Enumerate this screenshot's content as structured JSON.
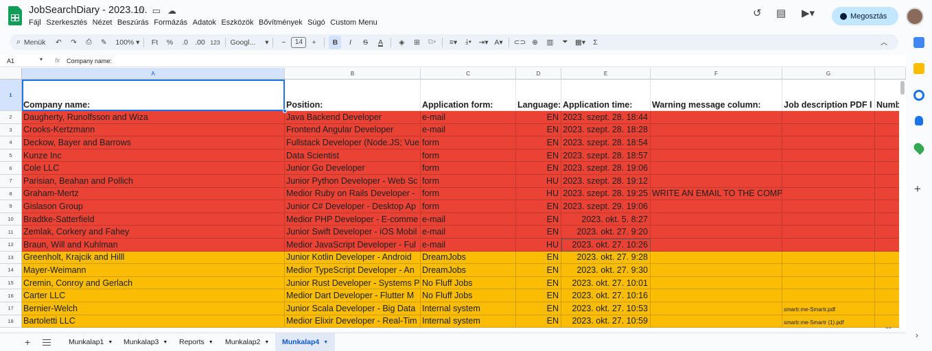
{
  "app": {
    "title": "JobSearchDiary - 2023.10.",
    "menus": [
      "Fájl",
      "Szerkesztés",
      "Nézet",
      "Beszúrás",
      "Formázás",
      "Adatok",
      "Eszközök",
      "Bővítmények",
      "Súgó",
      "Custom Menu"
    ],
    "share_label": "Megosztás"
  },
  "toolbar": {
    "search_label": "Menük",
    "zoom": "100%",
    "currency": "Ft",
    "percent": "%",
    "decimal_less": ".0",
    "decimal_more": ".00",
    "number_format": "123",
    "font": "Googl...",
    "font_size": "14",
    "bold": "B",
    "italic": "I",
    "strike": "S",
    "text_color": "A"
  },
  "formula_bar": {
    "cell_ref": "A1",
    "fx": "fx",
    "content": "Company name:"
  },
  "columns": [
    "A",
    "B",
    "C",
    "D",
    "E",
    "F",
    "G",
    ""
  ],
  "headers": [
    "Company name:",
    "Position:",
    "Application form:",
    "Language:",
    "Application time:",
    "Warning message column:",
    "Job description PDF l",
    "Numb"
  ],
  "rows": [
    {
      "n": "2",
      "color": "#ea4335",
      "cells": [
        "Daugherty, Runolfsson and Wiza",
        "Java Backend Developer",
        "e-mail",
        "EN",
        "2023. szept. 28. 18:44",
        "",
        ""
      ]
    },
    {
      "n": "3",
      "color": "#ea4335",
      "cells": [
        "Crooks-Kertzmann",
        "Frontend Angular Developer",
        "e-mail",
        "EN",
        "2023. szept. 28. 18:28",
        "",
        ""
      ]
    },
    {
      "n": "4",
      "color": "#ea4335",
      "cells": [
        "Deckow, Bayer and Barrows",
        "Fullstack Developer (Node.JS; Vue",
        "form",
        "EN",
        "2023. szept. 28. 18:54",
        "",
        ""
      ]
    },
    {
      "n": "5",
      "color": "#ea4335",
      "cells": [
        "Kunze Inc",
        "Data Scientist",
        "form",
        "EN",
        "2023. szept. 28. 18:57",
        "",
        ""
      ]
    },
    {
      "n": "6",
      "color": "#ea4335",
      "cells": [
        "Cole LLC",
        "Junior Go Developer",
        "form",
        "EN",
        "2023. szept. 28. 19:06",
        "",
        ""
      ]
    },
    {
      "n": "7",
      "color": "#ea4335",
      "cells": [
        "Parisian, Beahan and Pollich",
        "Junior Python Developer - Web Sc",
        "form",
        "HU",
        "2023. szept. 28. 19:12",
        "",
        ""
      ]
    },
    {
      "n": "8",
      "color": "#ea4335",
      "cells": [
        "Graham-Mertz",
        "Medior Ruby on Rails Developer -",
        "form",
        "HU",
        "2023. szept. 28. 19:25",
        "WRITE AN EMAIL TO THE COMPANY!",
        ""
      ]
    },
    {
      "n": "9",
      "color": "#ea4335",
      "cells": [
        "Gislason Group",
        "Junior C# Developer - Desktop Ap",
        "form",
        "EN",
        "2023. szept. 29. 19:06",
        "",
        ""
      ]
    },
    {
      "n": "10",
      "color": "#ea4335",
      "cells": [
        "Bradtke-Satterfield",
        "Medior PHP Developer - E-comme",
        "e-mail",
        "EN",
        "2023. okt. 5. 8:27",
        "",
        ""
      ]
    },
    {
      "n": "11",
      "color": "#ea4335",
      "cells": [
        "Zemlak, Corkery and Fahey",
        "Junior Swift Developer - iOS Mobil",
        "e-mail",
        "EN",
        "2023. okt. 27. 9:20",
        "",
        ""
      ]
    },
    {
      "n": "12",
      "color": "#ea4335",
      "cells": [
        "Braun, Will and Kuhlman",
        "Medior JavaScript Developer - Ful",
        "e-mail",
        "HU",
        "2023. okt. 27. 10:26",
        "",
        ""
      ]
    },
    {
      "n": "13",
      "color": "#fbbc04",
      "cells": [
        "Greenholt, Krajcik and Hilll",
        "Junior Kotlin Developer - Android",
        "DreamJobs",
        "EN",
        "2023. okt. 27. 9:28",
        "",
        ""
      ]
    },
    {
      "n": "14",
      "color": "#fbbc04",
      "cells": [
        "Mayer-Weimann",
        "Medior TypeScript Developer - An",
        "DreamJobs",
        "EN",
        "2023. okt. 27. 9:30",
        "",
        ""
      ]
    },
    {
      "n": "15",
      "color": "#fbbc04",
      "cells": [
        "Cremin, Conroy and Gerlach",
        "Junior Rust Developer - Systems P",
        "No Fluff Jobs",
        "EN",
        "2023. okt. 27. 10:01",
        "",
        ""
      ]
    },
    {
      "n": "16",
      "color": "#fbbc04",
      "cells": [
        "Carter LLC",
        "Medior Dart Developer - Flutter M",
        "No Fluff Jobs",
        "EN",
        "2023. okt. 27. 10:16",
        "",
        ""
      ]
    },
    {
      "n": "17",
      "color": "#fbbc04",
      "cells": [
        "Bernier-Welch",
        "Junior Scala Developer - Big Data",
        "Internal system",
        "EN",
        "2023. okt. 27. 10:53",
        "",
        "smartr.me-Smartr.pdf"
      ]
    },
    {
      "n": "18",
      "color": "#fbbc04",
      "cells": [
        "Bartoletti LLC",
        "Medior Elixir Developer - Real-Tim",
        "Internal system",
        "EN",
        "2023. okt. 27. 10:59",
        "",
        "smartr.me-Smartr (1).pdf"
      ]
    }
  ],
  "sheets": [
    {
      "label": "Munkalap1",
      "active": false
    },
    {
      "label": "Munkalap3",
      "active": false
    },
    {
      "label": "Reports",
      "active": false
    },
    {
      "label": "Munkalap2",
      "active": false
    },
    {
      "label": "Munkalap4",
      "active": true
    }
  ],
  "colors": {
    "red_rows": "#ea4335",
    "yellow_rows": "#fbbc04",
    "accent": "#1a73e8",
    "share_bg": "#c2e7ff"
  }
}
